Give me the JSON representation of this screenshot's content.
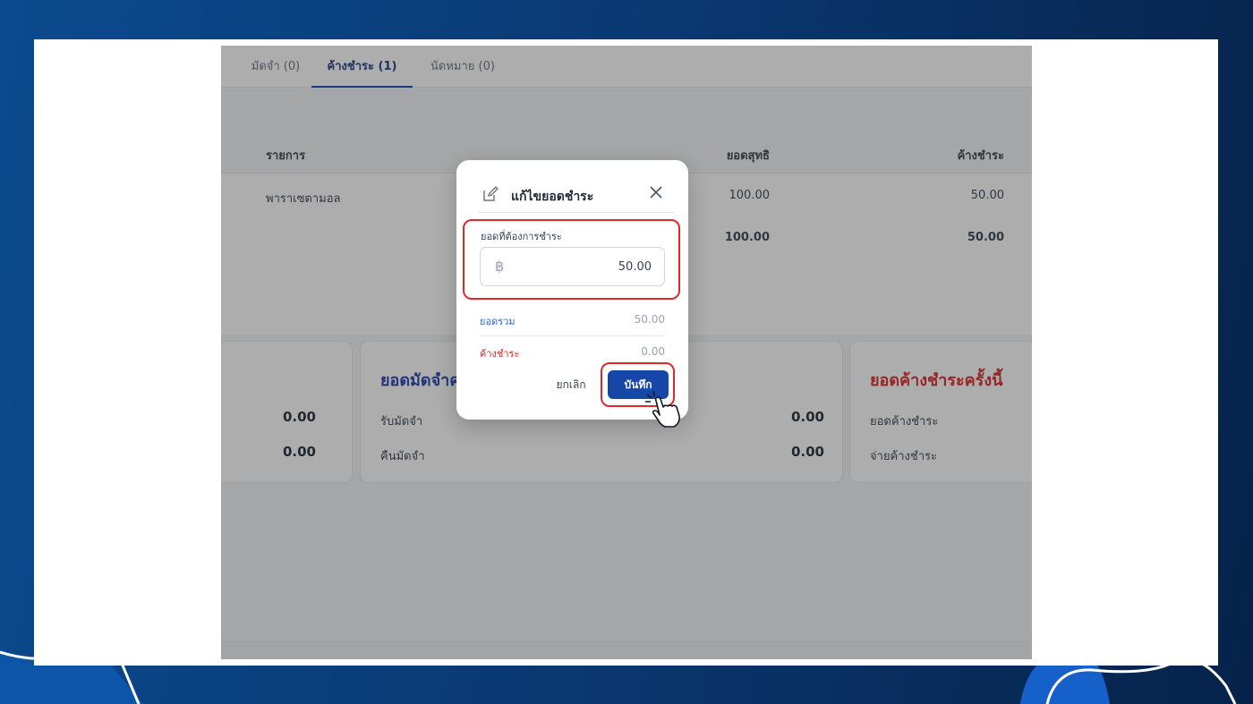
{
  "tabs": [
    {
      "label": "มัดจำ (0)",
      "active": false
    },
    {
      "label": "ค้างชำระ (1)",
      "active": true
    },
    {
      "label": "นัดหมาย (0)",
      "active": false
    }
  ],
  "table": {
    "headers": {
      "item": "รายการ",
      "net": "ยอดสุทธิ",
      "outstanding": "ค้างชำระ"
    },
    "rows": [
      {
        "item": "พาราเซตามอล",
        "net": "100.00",
        "outstanding": "50.00"
      }
    ],
    "total": {
      "net": "100.00",
      "outstanding": "50.00"
    }
  },
  "cards": {
    "left": {
      "values": [
        "0.00",
        "0.00"
      ]
    },
    "deposit": {
      "title": "ยอดมัดจำค",
      "labels": [
        "รับมัดจำ",
        "คืนมัดจำ"
      ],
      "values": [
        "0.00",
        "0.00"
      ]
    },
    "outstanding": {
      "title": "ยอดค้างชำระครั้งนี้",
      "labels": [
        "ยอดค้างชำระ",
        "จ่ายค้างชำระ"
      ]
    }
  },
  "modal": {
    "title": "แก้ไขยอดชำระ",
    "field_label": "ยอดที่ต้องการชำระ",
    "currency_icon": "baht-icon",
    "amount": "50.00",
    "total_label": "ยอดรวม",
    "total_value": "50.00",
    "outstanding_label": "ค้างชำระ",
    "outstanding_value": "0.00",
    "cancel_label": "ยกเลิก",
    "save_label": "บันทึก"
  },
  "colors": {
    "primary": "#1646a8",
    "highlight": "#e0282c",
    "deposit_title": "#1e40af",
    "outstanding_title": "#dc2626",
    "total_label": "#2563eb",
    "outstanding_label": "#dc2626"
  }
}
